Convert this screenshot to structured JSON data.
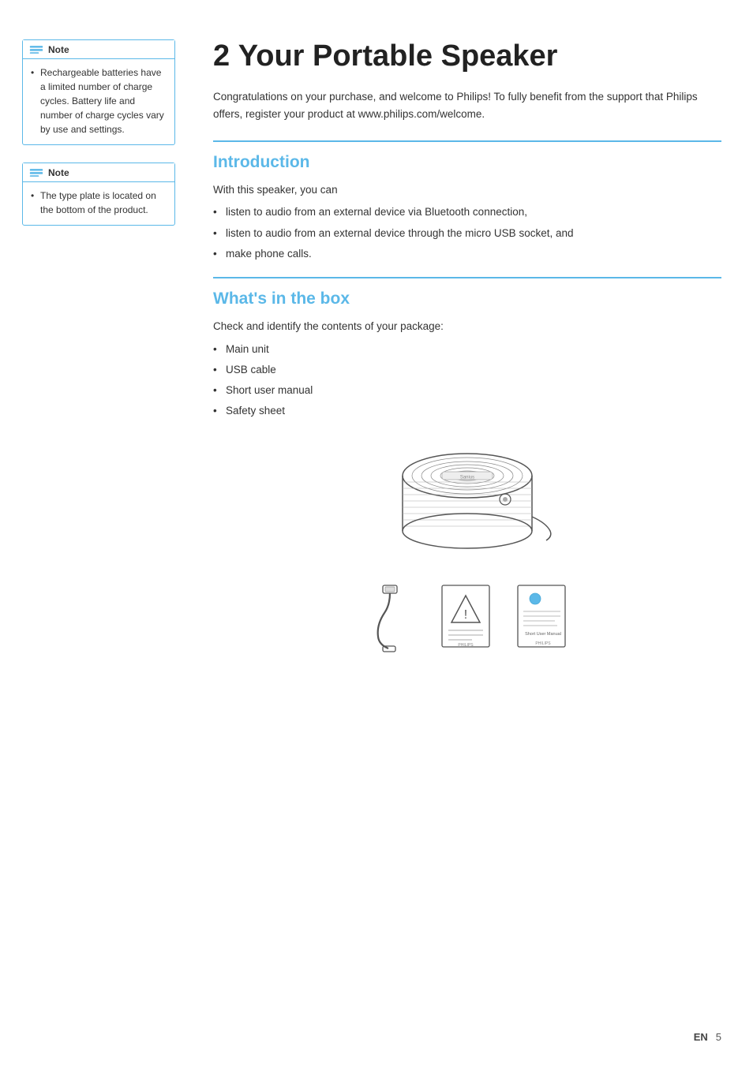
{
  "left": {
    "note1": {
      "label": "Note",
      "text": "Rechargeable batteries have a limited number of charge cycles. Battery life and number of charge cycles vary by use and settings."
    },
    "note2": {
      "label": "Note",
      "text": "The type plate is located on the bottom of the product."
    }
  },
  "right": {
    "chapter_number": "2",
    "chapter_title": "Your Portable Speaker",
    "intro": "Congratulations on your purchase, and welcome to Philips! To fully benefit from the support that Philips offers, register your product at www.philips.com/welcome.",
    "introduction": {
      "title": "Introduction",
      "lead": "With this speaker, you can",
      "items": [
        "listen to audio from an external device via Bluetooth connection,",
        "listen to audio from an external device through the micro USB socket, and",
        "make phone calls."
      ]
    },
    "whats_in_box": {
      "title": "What's in the box",
      "lead": "Check and identify the contents of your package:",
      "items": [
        "Main unit",
        "USB cable",
        "Short user manual",
        "Safety sheet"
      ]
    }
  },
  "footer": {
    "language": "EN",
    "page_number": "5"
  }
}
